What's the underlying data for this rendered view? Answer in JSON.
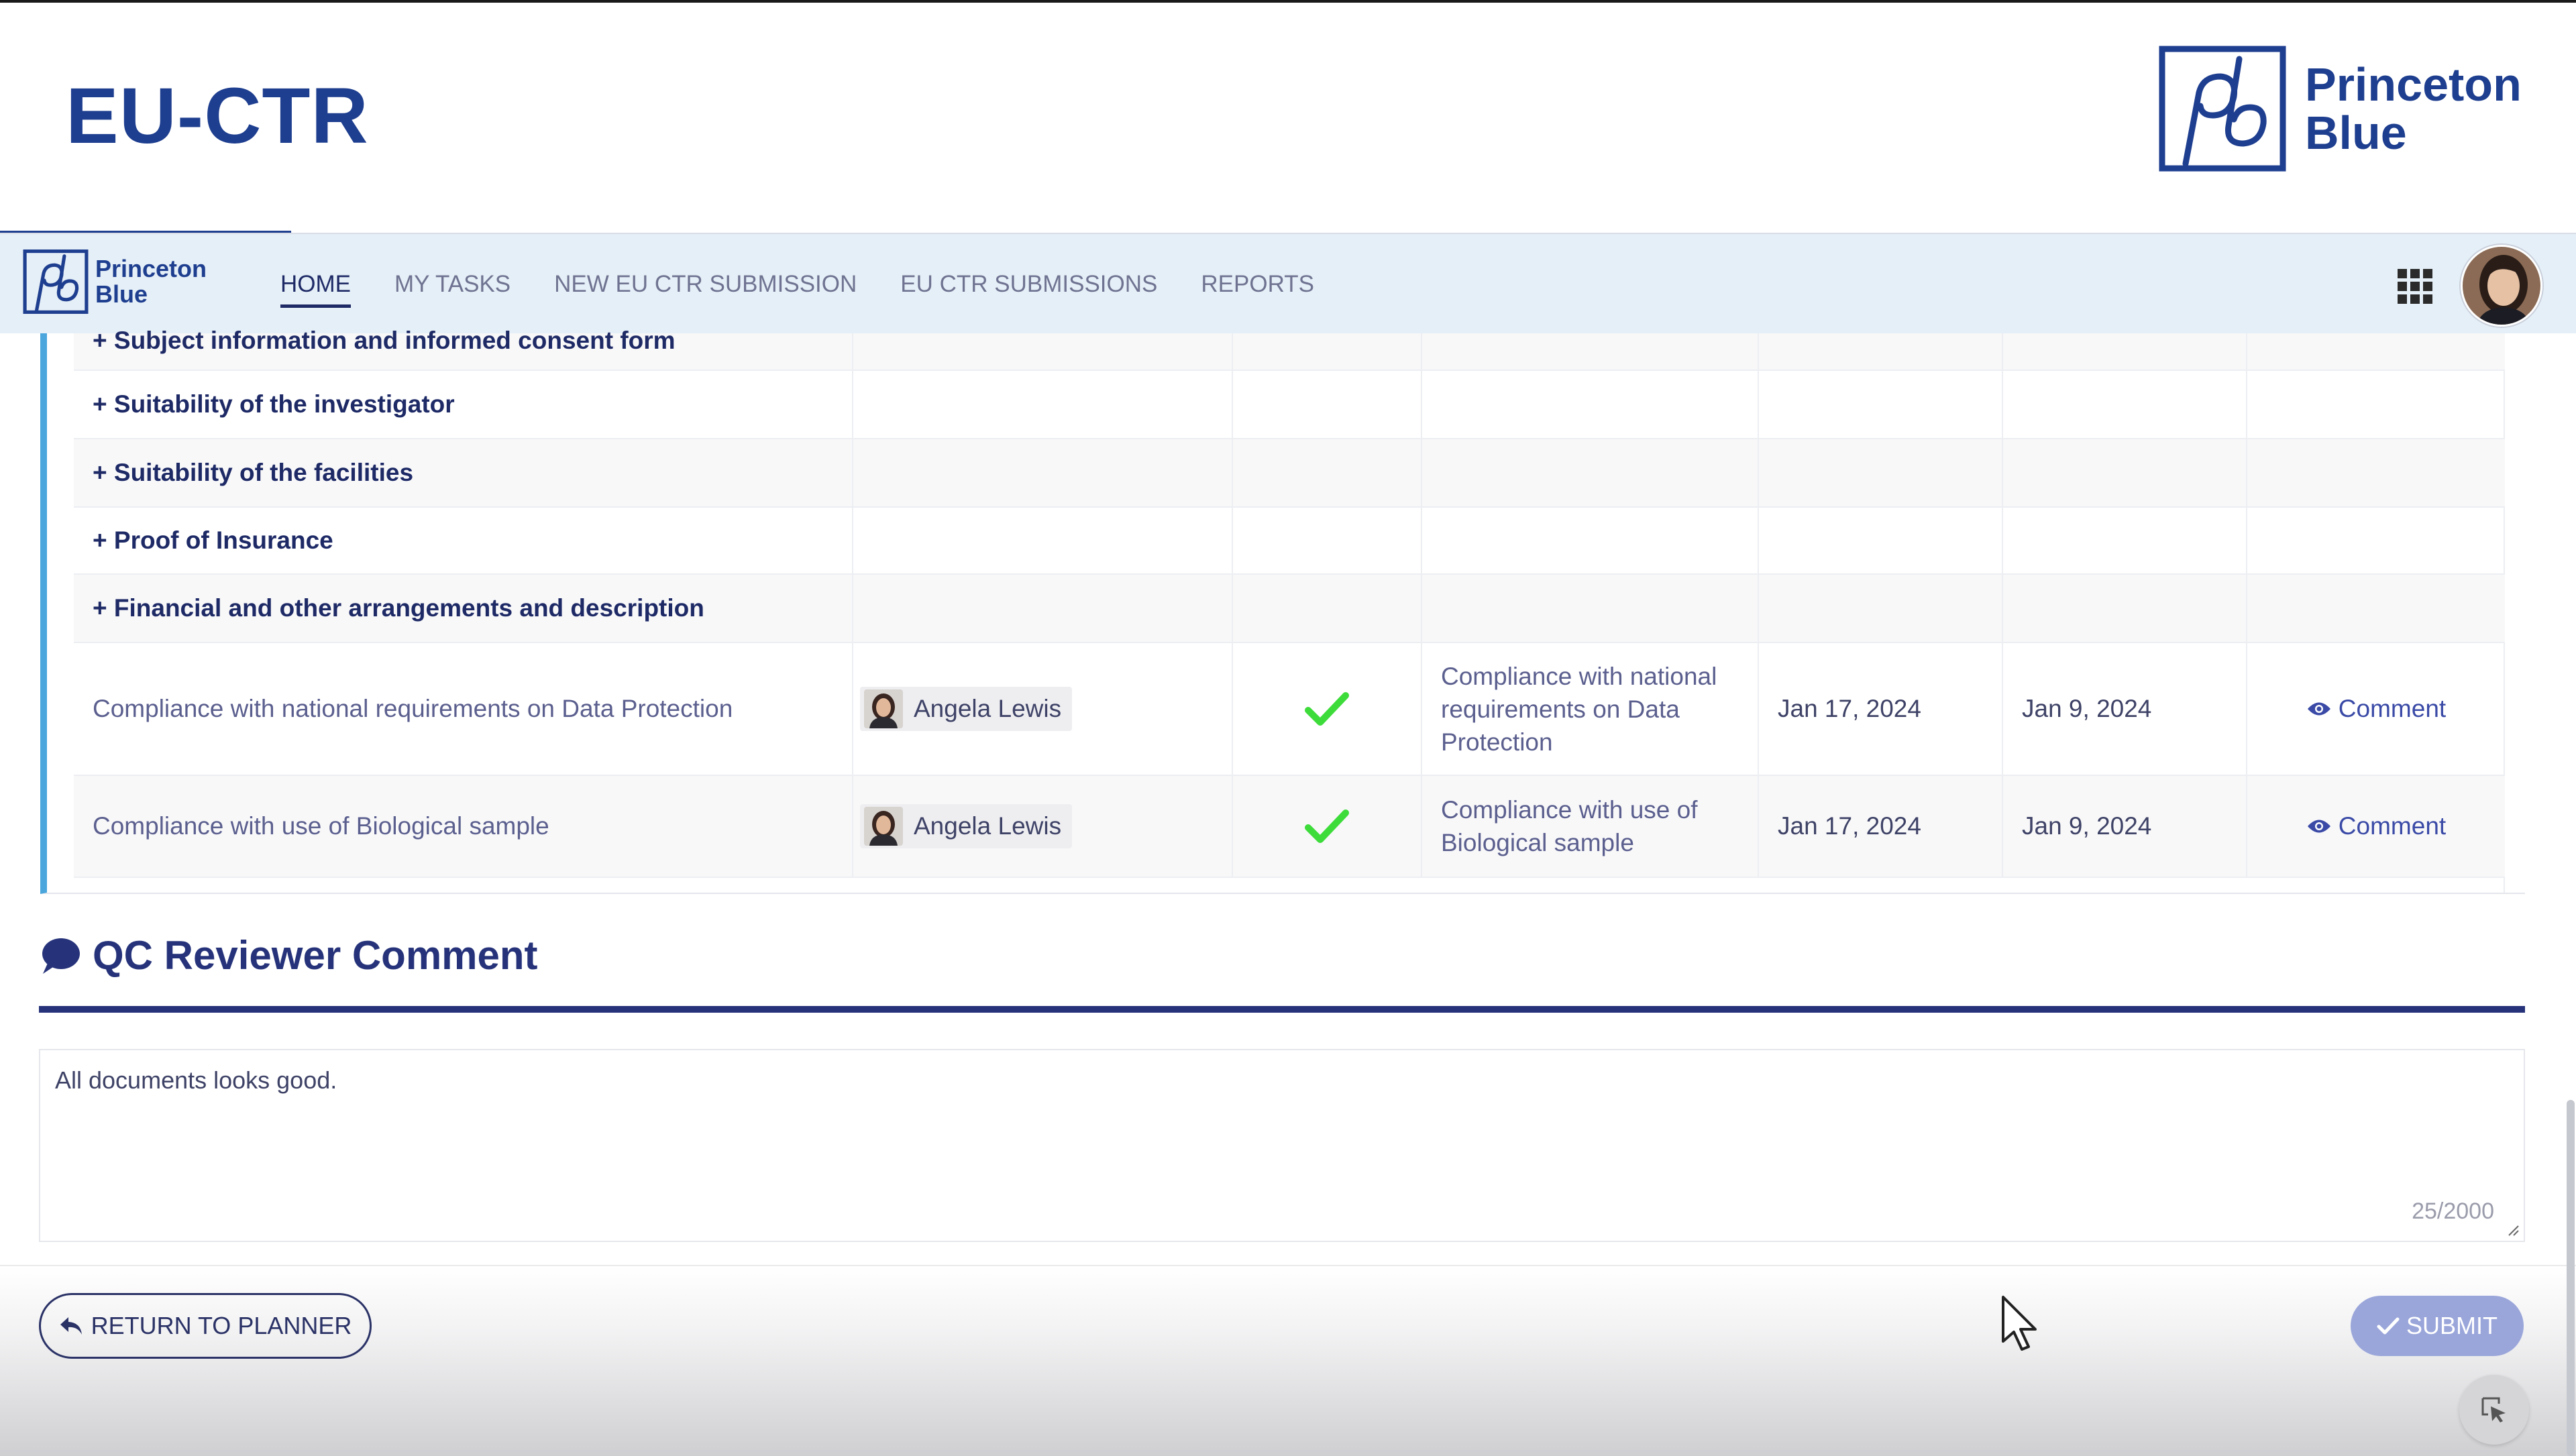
{
  "header": {
    "app_title": "EU-CTR",
    "brand_name_line1": "Princeton",
    "brand_name_line2": "Blue"
  },
  "nav": {
    "brand_line1": "Princeton",
    "brand_line2": "Blue",
    "items": [
      {
        "label": "HOME",
        "active": true
      },
      {
        "label": "MY TASKS",
        "active": false
      },
      {
        "label": "NEW EU CTR SUBMISSION",
        "active": false
      },
      {
        "label": "EU CTR SUBMISSIONS",
        "active": false
      },
      {
        "label": "REPORTS",
        "active": false
      }
    ]
  },
  "table": {
    "sections": [
      "+ Subject information and informed consent form",
      "+ Suitability of the investigator",
      "+ Suitability of the facilities",
      "+ Proof of Insurance",
      "+ Financial and other arrangements and description"
    ],
    "rows": [
      {
        "document": "Compliance with national requirements on Data Protection",
        "assignee": "Angela Lewis",
        "description_lines": [
          "Compliance with national",
          "requirements on Data",
          "Protection"
        ],
        "date1": "Jan 17, 2024",
        "date2": "Jan 9, 2024",
        "action": "Comment"
      },
      {
        "document": "Compliance with use of Biological sample",
        "assignee": "Angela Lewis",
        "description_lines": [
          "Compliance with use of",
          "Biological sample"
        ],
        "date1": "Jan 17, 2024",
        "date2": "Jan 9, 2024",
        "action": "Comment"
      }
    ]
  },
  "qc": {
    "heading": "QC Reviewer Comment",
    "comment_value": "All documents looks good.",
    "counter": "25/2000"
  },
  "footer": {
    "return_label": "RETURN TO PLANNER",
    "submit_label": "SUBMIT"
  },
  "colors": {
    "brand": "#1e3e8f",
    "nav_bg": "#e5eff7",
    "accent_border": "#4aa6dc",
    "check": "#3ddc3a",
    "submit_disabled": "#9aa6da"
  }
}
